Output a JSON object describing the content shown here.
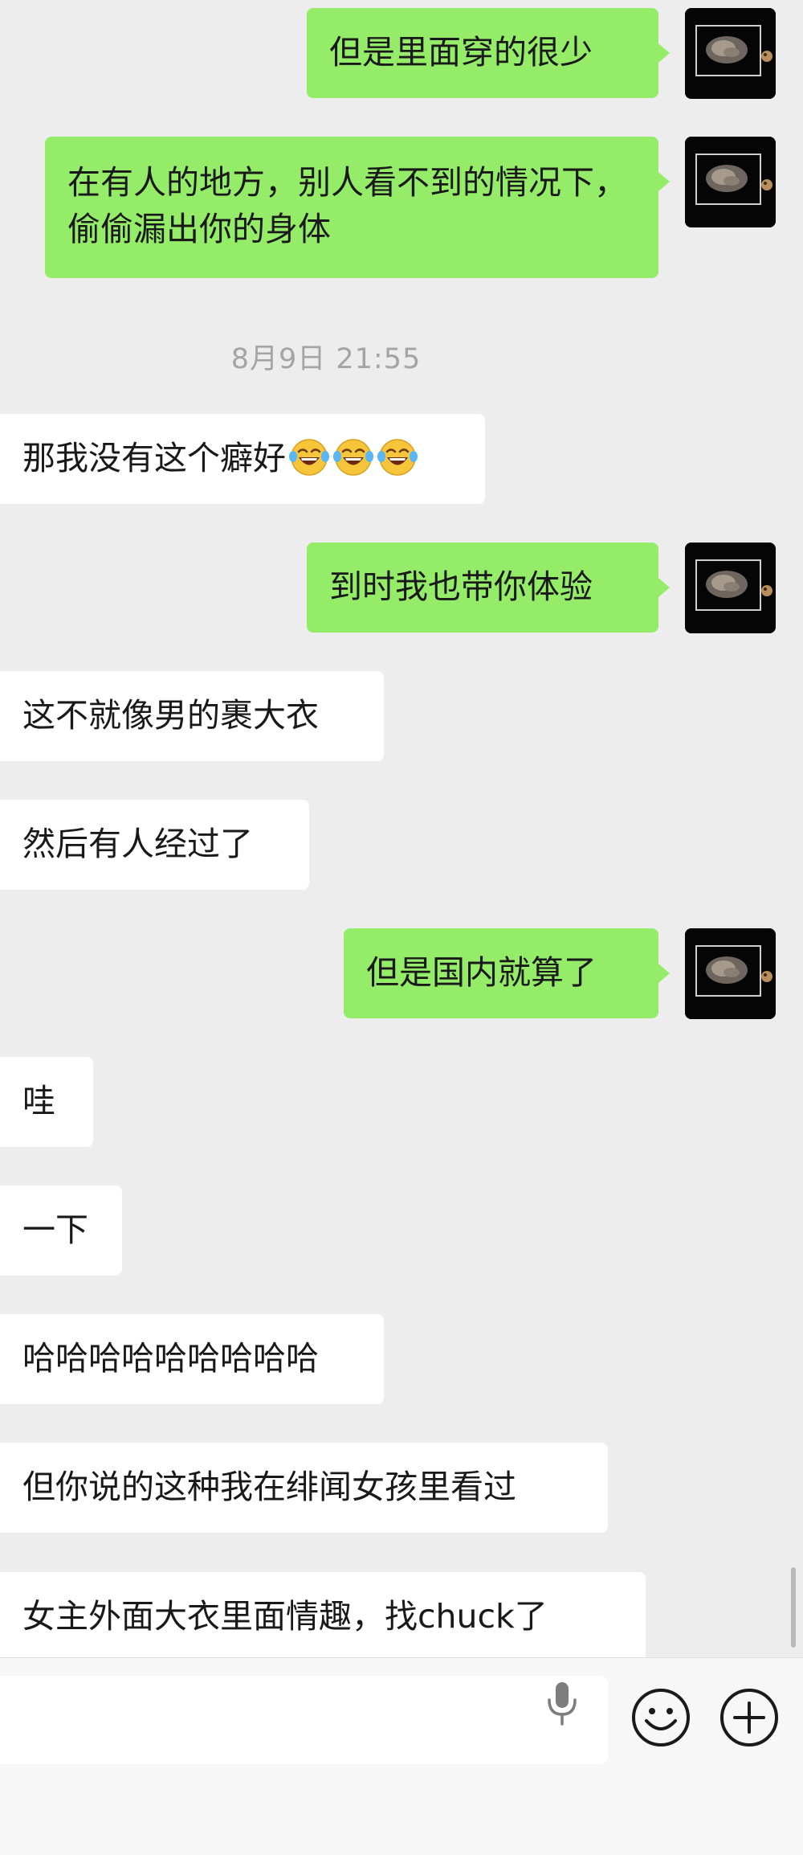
{
  "messages": {
    "m1": "但是里面穿的很少",
    "m2": "在有人的地方，别人看不到的情况下，偷偷漏出你的身体",
    "timestamp": "8月9日 21:55",
    "m3": "那我没有这个癖好",
    "m4": "到时我也带你体验",
    "m5": "这不就像男的裹大衣",
    "m6": "然后有人经过了",
    "m7": "但是国内就算了",
    "m8": "哇",
    "m9": "一下",
    "m10": "哈哈哈哈哈哈哈哈哈",
    "m11": "但你说的这种我在绯闻女孩里看过",
    "m12": "女主外面大衣里面情趣，找chuck了"
  },
  "icons": {
    "emoji_in_message": "tears-of-joy-emoji",
    "voice": "microphone-icon",
    "sticker": "smiley-face-icon",
    "more": "plus-circle-icon"
  },
  "colors": {
    "background": "#ededed",
    "outgoing_bubble": "#95ec69",
    "incoming_bubble": "#ffffff",
    "timestamp_text": "#a4a4a4"
  }
}
